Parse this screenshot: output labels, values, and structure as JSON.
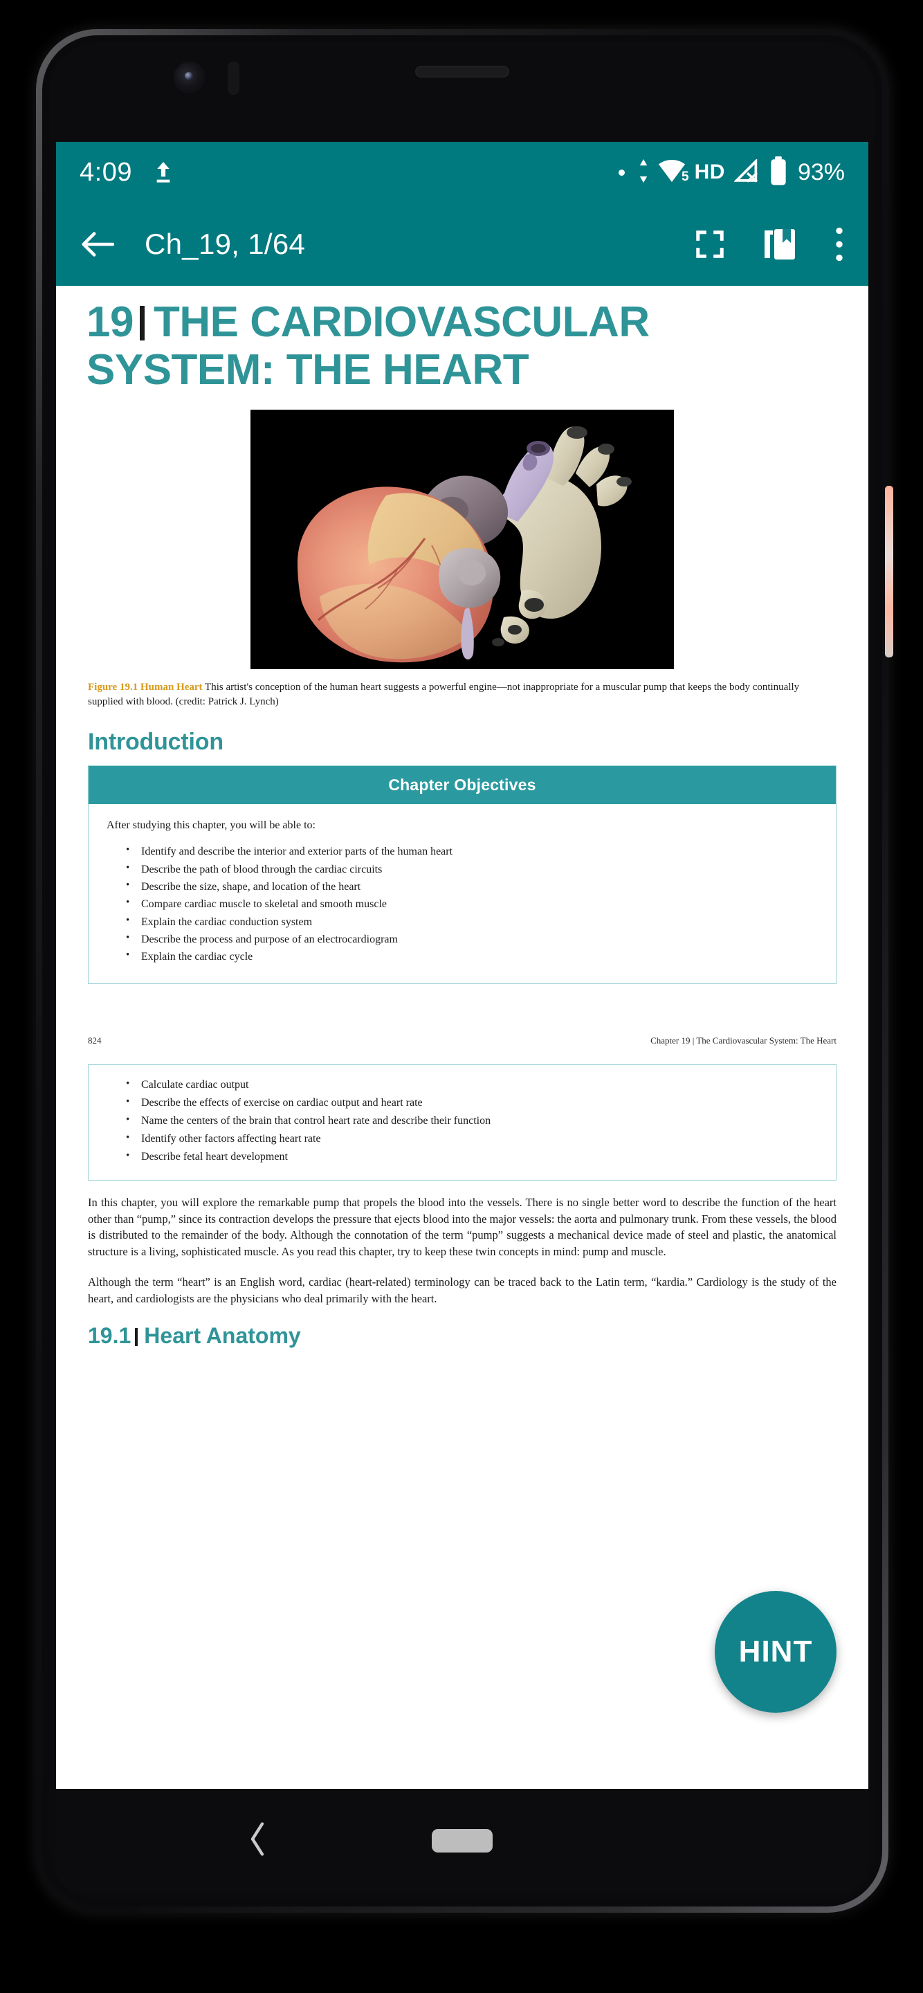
{
  "statusbar": {
    "time": "4:09",
    "upload_icon": "upload-icon",
    "notification_dot": "notification-dot",
    "data_transfer_icon": "data-transfer-icon",
    "wifi_icon": "wifi-icon",
    "wifi_badge": "5",
    "hd_label": "HD",
    "signal_icon": "signal-off-icon",
    "battery_icon": "battery-icon",
    "battery_percent": "93%",
    "background_color": "#00797f"
  },
  "toolbar": {
    "back_icon": "back-arrow-icon",
    "title": "Ch_19, 1/64",
    "fullscreen_icon": "fullscreen-icon",
    "bookmark_icon": "bookmark-icon",
    "overflow_icon": "more-vertical-icon",
    "background_color": "#00797f"
  },
  "document": {
    "chapter_number": "19",
    "chapter_title": "THE CARDIOVASCULAR SYSTEM: THE HEART",
    "accent_color": "#2f9498",
    "figure": {
      "alt": "anatomical-illustration-of-human-heart",
      "background_color": "#000000",
      "caption_label": "Figure 19.1 Human Heart",
      "caption_label_color": "#d79b1e",
      "caption_text": "This artist's conception of the human heart suggests a powerful engine—not inappropriate for a muscular pump that keeps the body continually supplied with blood. (credit: Patrick J. Lynch)"
    },
    "introduction_heading": "Introduction",
    "objectives_box": {
      "header": "Chapter Objectives",
      "header_color": "#2b9aa0",
      "intro": "After studying this chapter, you will be able to:",
      "items": [
        "Identify and describe the interior and exterior parts of the human heart",
        "Describe the path of blood through the cardiac circuits",
        "Describe the size, shape, and location of the heart",
        "Compare cardiac muscle to skeletal and smooth muscle",
        "Explain the cardiac conduction system",
        "Describe the process and purpose of an electrocardiogram",
        "Explain the cardiac cycle"
      ]
    },
    "page_footer": {
      "page_number": "824",
      "running_head": "Chapter 19 | The Cardiovascular System: The Heart"
    },
    "objectives_box_continued": {
      "items": [
        "Calculate cardiac output",
        "Describe the effects of exercise on cardiac output and heart rate",
        "Name the centers of the brain that control heart rate and describe their function",
        "Identify other factors affecting heart rate",
        "Describe fetal heart development"
      ]
    },
    "paragraphs": [
      "In this chapter, you will explore the remarkable pump that propels the blood into the vessels. There is no single better word to describe the function of the heart other than “pump,” since its contraction develops the pressure that ejects blood into the major vessels: the aorta and pulmonary trunk. From these vessels, the blood is distributed to the remainder of the body. Although the connotation of the term “pump” suggests a mechanical device made of steel and plastic, the anatomical structure is a living, sophisticated muscle. As you read this chapter, try to keep these twin concepts in mind: pump and muscle.",
      "Although the term “heart” is an English word, cardiac (heart-related) terminology can be traced back to the Latin term, “kardia.” Cardiology is the study of the heart, and cardiologists are the physicians who deal primarily with the heart."
    ],
    "subsection": {
      "number": "19.1",
      "title": "Heart Anatomy"
    }
  },
  "fab": {
    "label": "HINT",
    "color": "#12838a"
  },
  "navbar": {
    "back_icon": "nav-back-icon",
    "home_pill": "nav-home-pill"
  }
}
